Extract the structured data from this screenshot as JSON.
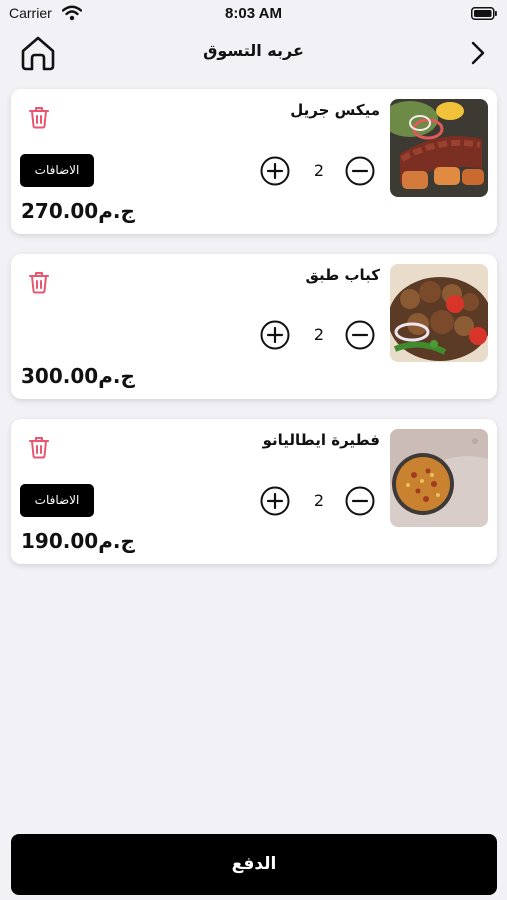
{
  "status_bar": {
    "carrier": "Carrier",
    "time": "8:03 AM"
  },
  "header": {
    "title": "عربه التسوق"
  },
  "cart": {
    "items": [
      {
        "name": "ميكس جريل",
        "quantity": "2",
        "price": "270.00",
        "currency": "ج.م",
        "addons_label": "الاضافات"
      },
      {
        "name": "كباب طبق",
        "quantity": "2",
        "price": "300.00",
        "currency": "ج.م"
      },
      {
        "name": "فطيرة ايطاليانو",
        "quantity": "2",
        "price": "190.00",
        "currency": "ج.م",
        "addons_label": "الاضافات"
      }
    ]
  },
  "footer": {
    "pay_label": "الدفع"
  },
  "colors": {
    "accent": "#000000",
    "trash": "#e8566f",
    "background": "#f1f1f6"
  },
  "icons": [
    "home-icon",
    "chevron-right-icon",
    "trash-icon",
    "plus-circle-icon",
    "minus-circle-icon",
    "wifi-icon",
    "battery-icon"
  ]
}
